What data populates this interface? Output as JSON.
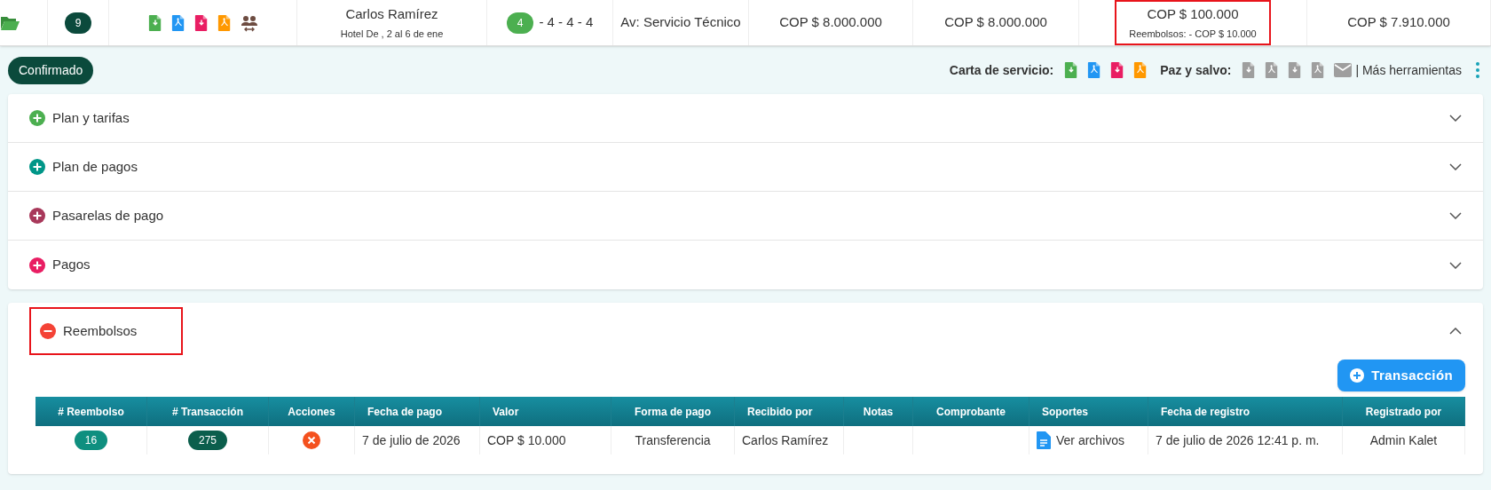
{
  "booking_row": {
    "count": "9",
    "guest_name": "Carlos Ramírez",
    "guest_detail": "Hotel De , 2 al 6 de ene",
    "room_badge": "4",
    "room_rest": "- 4 - 4 - 4",
    "agent": "Av: Servicio Técnico",
    "amounts": [
      {
        "text": "COP $ 8.000.000",
        "highlighted": false
      },
      {
        "text": "COP $ 8.000.000",
        "highlighted": false
      },
      {
        "text": "COP $ 100.000",
        "note": "Reembolsos: - COP $ 10.000",
        "highlighted": true
      },
      {
        "text": "COP $ 7.910.000",
        "highlighted": false
      }
    ]
  },
  "status": "Confirmado",
  "tools": {
    "service_letter_label": "Carta de servicio:",
    "clearance_label": "Paz y salvo:",
    "more_tools": "| Más herramientas"
  },
  "panels": [
    {
      "title": "Plan y tarifas",
      "color": "#4caf50",
      "expanded": false,
      "highlighted": false
    },
    {
      "title": "Plan de pagos",
      "color": "#009688",
      "expanded": false,
      "highlighted": false
    },
    {
      "title": "Pasarelas de pago",
      "color": "#a8385a",
      "expanded": false,
      "highlighted": false
    },
    {
      "title": "Pagos",
      "color": "#e91e63",
      "expanded": false,
      "highlighted": false
    },
    {
      "title": "Reembolsos",
      "color": "#f44336",
      "expanded": true,
      "highlighted": true
    }
  ],
  "refunds": {
    "add_button": "Transacción",
    "columns": [
      "# Reembolso",
      "# Transacción",
      "Acciones",
      "Fecha de pago",
      "Valor",
      "Forma de pago",
      "Recibido por",
      "Notas",
      "Comprobante",
      "Soportes",
      "Fecha de registro",
      "Registrado por"
    ],
    "rows": [
      {
        "refund": "16",
        "transaction": "275",
        "payment_date": "7 de julio de 2026",
        "amount": "COP $ 10.000",
        "method": "Transferencia",
        "received_by": "Carlos Ramírez",
        "supports": "Ver archivos",
        "registered_at": "7 de julio de 2026 12:41 p. m.",
        "registered_by": "Admin Kalet"
      }
    ]
  }
}
